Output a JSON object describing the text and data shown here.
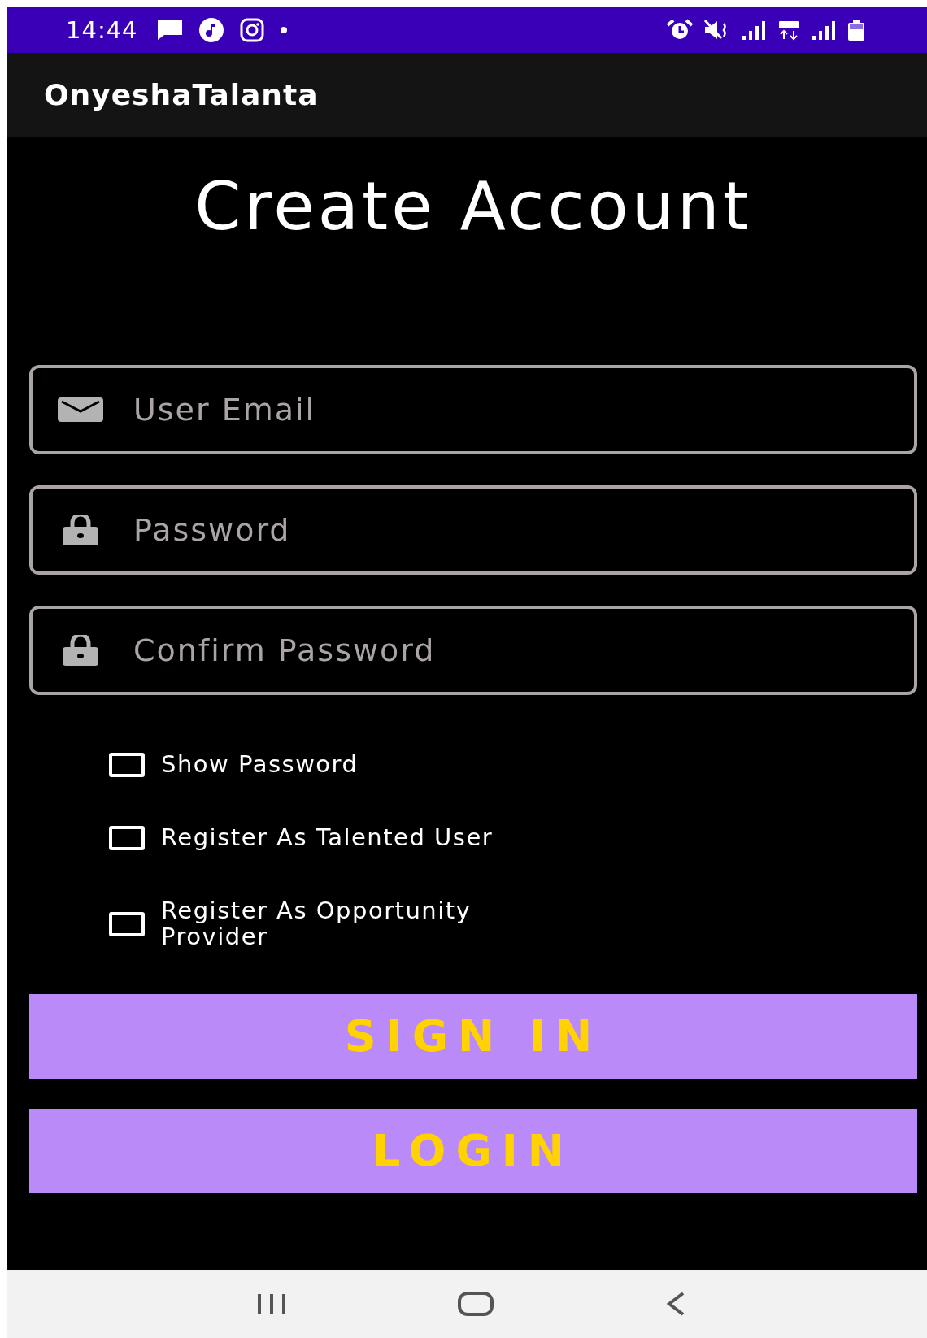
{
  "status_bar": {
    "time": "14:44"
  },
  "app_bar": {
    "title": "OnyeshaTalanta"
  },
  "heading": "Create Account",
  "fields": [
    {
      "kind": "email",
      "placeholder": "User Email"
    },
    {
      "kind": "password",
      "placeholder": "Password"
    },
    {
      "kind": "password",
      "placeholder": "Confirm Password"
    }
  ],
  "checkboxes": [
    {
      "label": "Show Password",
      "checked": false
    },
    {
      "label": "Register As Talented User",
      "checked": false
    },
    {
      "label": "Register As Opportunity Provider",
      "checked": false
    }
  ],
  "buttons": [
    "SIGN IN",
    "LOGIN"
  ]
}
